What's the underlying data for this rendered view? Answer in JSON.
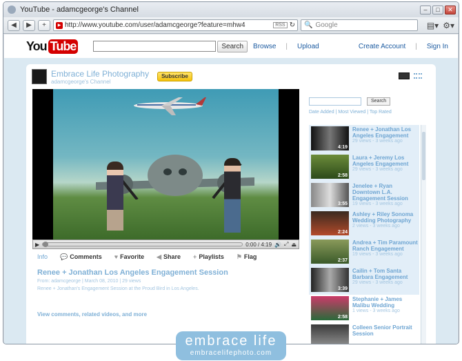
{
  "window": {
    "title": "YouTube - adamcgeorge's Channel"
  },
  "browser": {
    "url": "http://www.youtube.com/user/adamcgeorge?feature=mhw4",
    "rss_label": "RSS",
    "search_placeholder": "Google"
  },
  "youtube": {
    "logo_you": "You",
    "logo_tube": "Tube",
    "search_button": "Search",
    "links": [
      "Browse",
      "Upload"
    ],
    "right_links": [
      "Create Account",
      "Sign In"
    ]
  },
  "channel": {
    "name": "Embrace Life Photography",
    "subtitle": "adamcgeorge's Channel",
    "subscribe_label": "Subscribe"
  },
  "player": {
    "time": "0:00 / 4:19"
  },
  "actions": {
    "info": "Info",
    "comments": "Comments",
    "favorite": "Favorite",
    "share": "Share",
    "playlists": "Playlists",
    "flag": "Flag"
  },
  "video": {
    "title": "Renee + Jonathan Los Angeles Engagement Session",
    "meta": "From: adamcgeorge | March 08, 2010 | 29 views",
    "description": "Renee + Jonathan's Engagement Session at the Proud Bird in Los Angeles.",
    "more_link": "View comments, related videos, and more"
  },
  "sidebar": {
    "search_button": "Search",
    "filters": [
      "Date Added",
      "Most Viewed",
      "Top Rated"
    ],
    "items": [
      {
        "title": "Renee + Jonathan Los Angeles Engagement",
        "meta": "29 views - 3 weeks ago",
        "duration": "4:19"
      },
      {
        "title": "Laura + Jeremy Los Angeles Engagement",
        "meta": "29 views - 3 weeks ago",
        "duration": "2:58"
      },
      {
        "title": "Jenelee + Ryan Downtown L.A. Engagement Session",
        "meta": "19 views - 3 weeks ago",
        "duration": "3:55"
      },
      {
        "title": "Ashley + Riley Sonoma Wedding Photography",
        "meta": "2 views - 3 weeks ago",
        "duration": "2:24"
      },
      {
        "title": "Andrea + Tim Paramount Ranch Engagement",
        "meta": "19 views - 3 weeks ago",
        "duration": "2:37"
      },
      {
        "title": "Cailin + Tom Santa Barbara Engagement",
        "meta": "29 views - 3 weeks ago",
        "duration": "3:39"
      },
      {
        "title": "Stephanie + James Malibu Wedding",
        "meta": "1 views - 3 weeks ago",
        "duration": "2:58"
      },
      {
        "title": "Colleen Senior Portrait Session",
        "meta": "",
        "duration": ""
      }
    ]
  },
  "watermark": {
    "line1": "embrace life",
    "line2": "embracelifephoto.com"
  },
  "colors": {
    "accent": "#7fb0d6",
    "youtube_red": "#d40000",
    "page_bg": "#dbe9f2"
  }
}
